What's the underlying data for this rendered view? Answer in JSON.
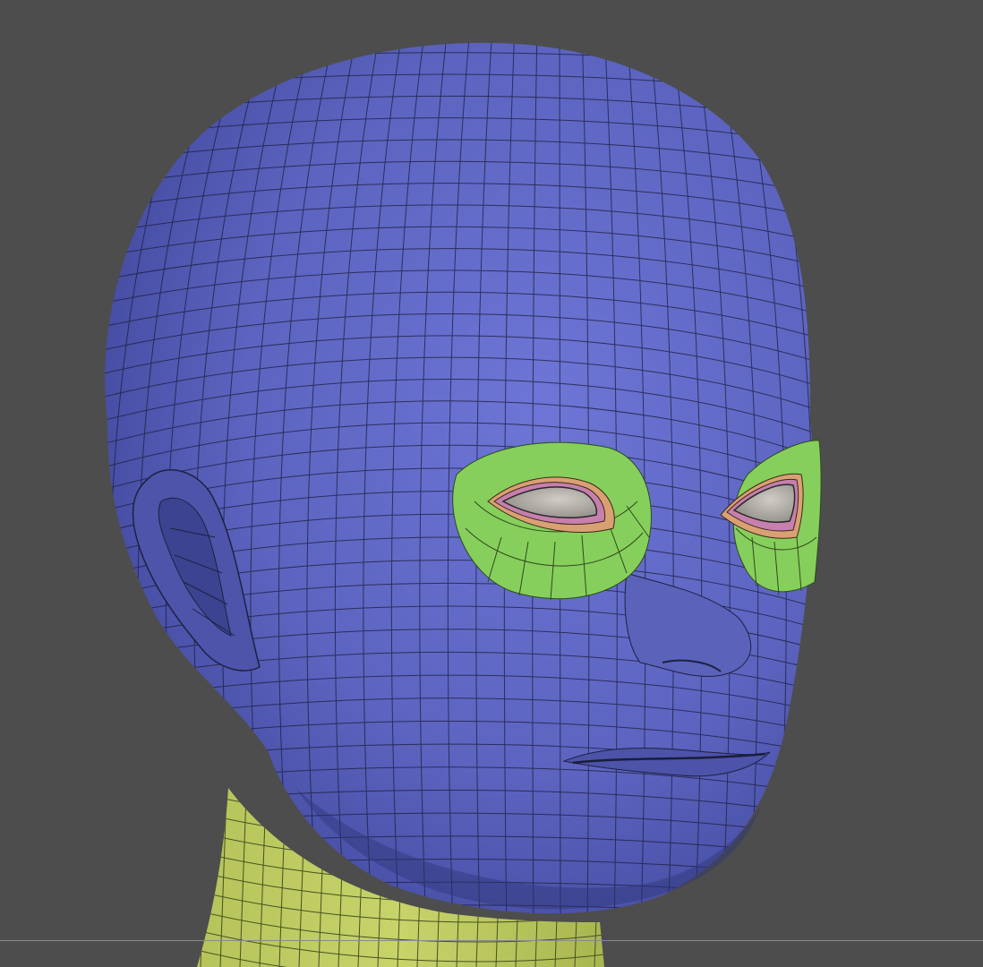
{
  "viewport": {
    "background_color": "#4d4d4d",
    "mesh_wire_color": "#1e2140"
  },
  "materials": {
    "head": "#5f67c4",
    "neck": "#c2cf63",
    "eye_ring": "#86cf5c",
    "eyelid_inner": "#d9a073",
    "eyelid_rim": "#c77fae",
    "eyeball": "#b8b4ae"
  },
  "model": {
    "icon": "polygon-mesh-icon",
    "parts": [
      "head",
      "neck",
      "left-ear",
      "left-eye-region",
      "right-eye-region",
      "nose",
      "mouth"
    ]
  }
}
